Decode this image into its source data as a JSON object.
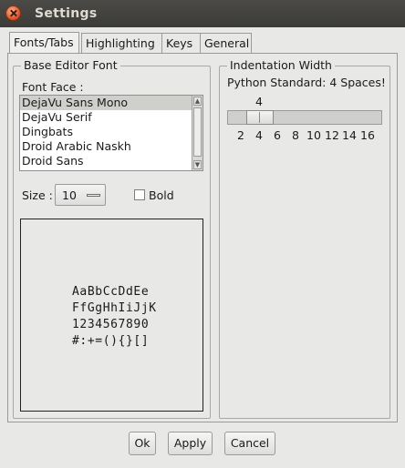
{
  "window": {
    "title": "Settings",
    "close_icon": "close-icon"
  },
  "tabs": [
    {
      "label": "Fonts/Tabs",
      "active": true
    },
    {
      "label": "Highlighting",
      "active": false
    },
    {
      "label": "Keys",
      "active": false
    },
    {
      "label": "General",
      "active": false
    }
  ],
  "font_group": {
    "title": "Base Editor Font",
    "font_face_label": "Font Face :",
    "font_list": [
      "DejaVu Sans Mono",
      "DejaVu Serif",
      "Dingbats",
      "Droid Arabic Naskh",
      "Droid Sans"
    ],
    "selected_font": "DejaVu Sans Mono",
    "size_label": "Size :",
    "size_value": "10",
    "bold_label": "Bold",
    "bold_checked": false,
    "preview_lines": [
      "AaBbCcDdEe",
      "FfGgHhIiJjK",
      "1234567890",
      "#:+=(){}[]"
    ]
  },
  "indent_group": {
    "title": "Indentation Width",
    "description": "Python Standard: 4 Spaces!",
    "current_value": "4",
    "tick_labels": [
      "2",
      "4",
      "6",
      "8",
      "10",
      "12",
      "14",
      "16"
    ]
  },
  "buttons": {
    "ok": "Ok",
    "apply": "Apply",
    "cancel": "Cancel"
  }
}
